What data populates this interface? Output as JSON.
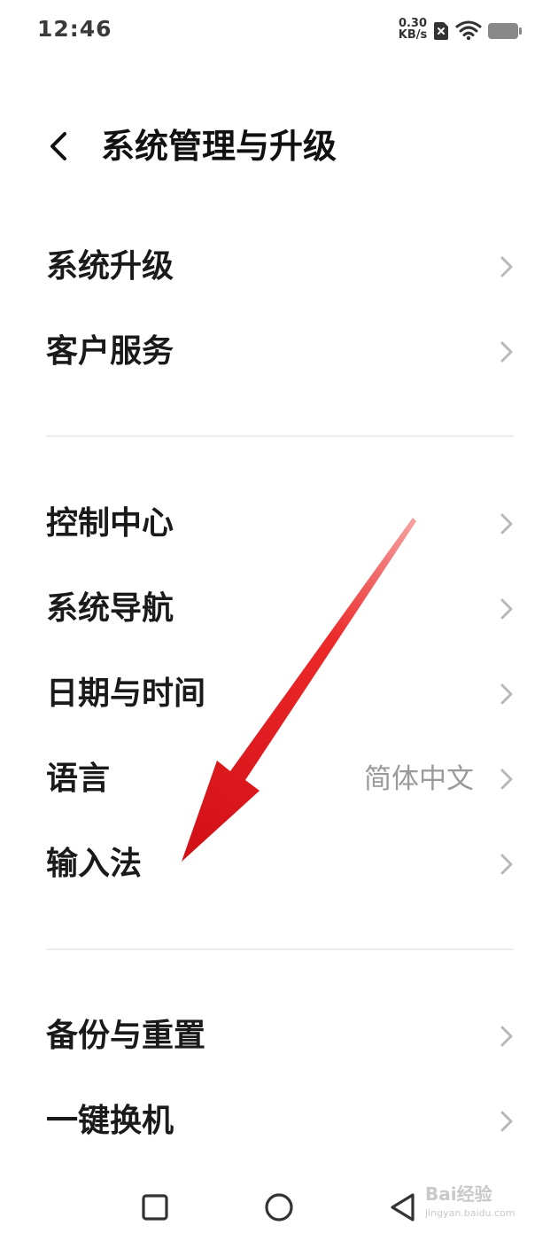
{
  "status_bar": {
    "time": "12:46",
    "net_speed_value": "0.30",
    "net_speed_unit": "KB/s",
    "icons": [
      "sim-disabled-icon",
      "wifi-icon",
      "battery-icon"
    ]
  },
  "header": {
    "back_icon": "chevron-left-icon",
    "title": "系统管理与升级"
  },
  "groups": [
    {
      "items": [
        {
          "label": "系统升级",
          "value": ""
        },
        {
          "label": "客户服务",
          "value": ""
        }
      ]
    },
    {
      "items": [
        {
          "label": "控制中心",
          "value": ""
        },
        {
          "label": "系统导航",
          "value": ""
        },
        {
          "label": "日期与时间",
          "value": ""
        },
        {
          "label": "语言",
          "value": "简体中文"
        },
        {
          "label": "输入法",
          "value": ""
        }
      ]
    },
    {
      "items": [
        {
          "label": "备份与重置",
          "value": ""
        },
        {
          "label": "一键换机",
          "value": ""
        }
      ]
    }
  ],
  "nav_bar": {
    "buttons": [
      "recents-square-icon",
      "home-circle-icon",
      "back-triangle-icon"
    ]
  },
  "colors": {
    "annotation_arrow": "#e8141c",
    "chevron": "#b8b8b8",
    "divider": "#ececec"
  },
  "watermark": {
    "text": "Bai经验",
    "subtext": "jingyan.baidu.com"
  }
}
